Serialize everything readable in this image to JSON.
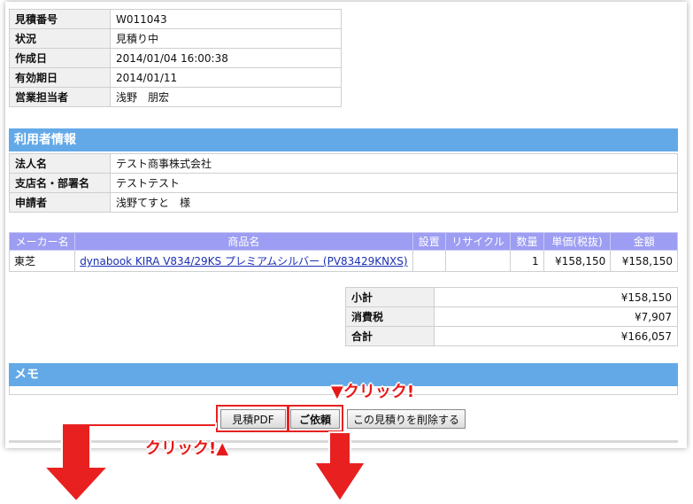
{
  "estimate": [
    {
      "key": "見積番号",
      "value": "W011043"
    },
    {
      "key": "状況",
      "value": "見積り中"
    },
    {
      "key": "作成日",
      "value": "2014/01/04 16:00:38"
    },
    {
      "key": "有効期日",
      "value": "2014/01/11"
    },
    {
      "key": "営業担当者",
      "value": "浅野　朋宏"
    }
  ],
  "user_section": {
    "title": "利用者情報",
    "rows": [
      {
        "key": "法人名",
        "value": "テスト商事株式会社"
      },
      {
        "key": "支店名・部署名",
        "value": "テストテスト"
      },
      {
        "key": "申請者",
        "value": "浅野てすと　様"
      }
    ]
  },
  "products": {
    "headers": [
      "メーカー名",
      "商品名",
      "設置",
      "リサイクル",
      "数量",
      "単価(税抜)",
      "金額"
    ],
    "rows": [
      {
        "maker": "東芝",
        "name": "dynabook KIRA V834/29KS プレミアムシルバー (PV83429KNXS)",
        "install": "",
        "recycle": "",
        "qty": "1",
        "unit_price": "¥158,150",
        "amount": "¥158,150"
      }
    ]
  },
  "summary": [
    {
      "key": "小計",
      "value": "¥158,150"
    },
    {
      "key": "消費税",
      "value": "¥7,907"
    },
    {
      "key": "合計",
      "value": "¥166,057"
    }
  ],
  "memo": {
    "title": "メモ"
  },
  "buttons": {
    "pdf": "見積PDF",
    "request": "ご依頼",
    "delete": "この見積りを削除する"
  },
  "annotations": {
    "click_top": "▼クリック!",
    "click_bottom": "クリック!▲"
  },
  "colors": {
    "section_header": "#63a9e8",
    "table_header": "#9d9df3",
    "highlight": "#e82020"
  }
}
